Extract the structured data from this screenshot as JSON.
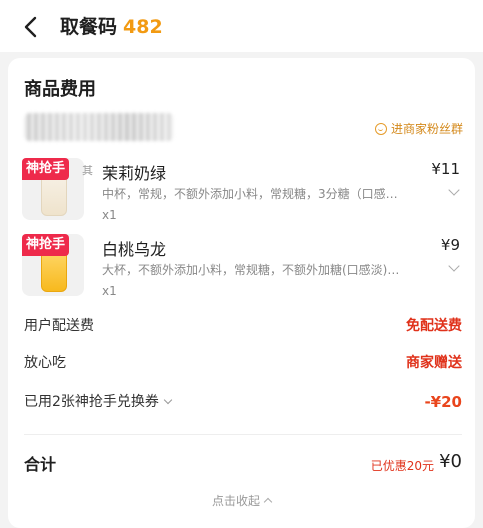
{
  "header": {
    "title_prefix": "取餐码",
    "pickup_code": "482"
  },
  "order_card": {
    "title": "商品费用",
    "fans_group_label": "进商家粉丝群"
  },
  "items": [
    {
      "tag": "神抢手",
      "tag_suffix": "其",
      "name": "茉莉奶绿",
      "price": "¥11",
      "spec": "中杯，常规，不额外添加小料，常规糖，3分糖（口感…",
      "qty": "x1"
    },
    {
      "tag": "神抢手",
      "name": "白桃乌龙",
      "price": "¥9",
      "spec": "大杯，不额外添加小料，常规糖，不额外加糖(口感淡)…",
      "qty": "x1"
    }
  ],
  "fees": {
    "delivery_label": "用户配送费",
    "delivery_value": "免配送费",
    "insurance_label": "放心吃",
    "insurance_value": "商家赠送",
    "voucher_label": "已用2张神抢手兑换券",
    "voucher_value": "-¥20"
  },
  "total": {
    "label": "合计",
    "saved": "已优惠20元",
    "amount": "¥0"
  },
  "collapse_label": "点击收起",
  "colors": {
    "accent_orange": "#f29a12",
    "promo_red": "#e0321b",
    "tag_red": "#ee2a4b"
  }
}
